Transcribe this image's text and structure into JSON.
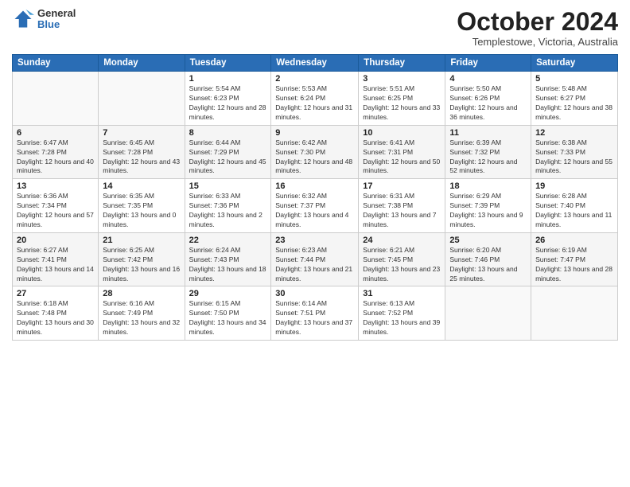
{
  "header": {
    "logo_general": "General",
    "logo_blue": "Blue",
    "month_title": "October 2024",
    "location": "Templestowe, Victoria, Australia"
  },
  "days_of_week": [
    "Sunday",
    "Monday",
    "Tuesday",
    "Wednesday",
    "Thursday",
    "Friday",
    "Saturday"
  ],
  "weeks": [
    [
      {
        "day": "",
        "info": ""
      },
      {
        "day": "",
        "info": ""
      },
      {
        "day": "1",
        "info": "Sunrise: 5:54 AM\nSunset: 6:23 PM\nDaylight: 12 hours and 28 minutes."
      },
      {
        "day": "2",
        "info": "Sunrise: 5:53 AM\nSunset: 6:24 PM\nDaylight: 12 hours and 31 minutes."
      },
      {
        "day": "3",
        "info": "Sunrise: 5:51 AM\nSunset: 6:25 PM\nDaylight: 12 hours and 33 minutes."
      },
      {
        "day": "4",
        "info": "Sunrise: 5:50 AM\nSunset: 6:26 PM\nDaylight: 12 hours and 36 minutes."
      },
      {
        "day": "5",
        "info": "Sunrise: 5:48 AM\nSunset: 6:27 PM\nDaylight: 12 hours and 38 minutes."
      }
    ],
    [
      {
        "day": "6",
        "info": "Sunrise: 6:47 AM\nSunset: 7:28 PM\nDaylight: 12 hours and 40 minutes."
      },
      {
        "day": "7",
        "info": "Sunrise: 6:45 AM\nSunset: 7:28 PM\nDaylight: 12 hours and 43 minutes."
      },
      {
        "day": "8",
        "info": "Sunrise: 6:44 AM\nSunset: 7:29 PM\nDaylight: 12 hours and 45 minutes."
      },
      {
        "day": "9",
        "info": "Sunrise: 6:42 AM\nSunset: 7:30 PM\nDaylight: 12 hours and 48 minutes."
      },
      {
        "day": "10",
        "info": "Sunrise: 6:41 AM\nSunset: 7:31 PM\nDaylight: 12 hours and 50 minutes."
      },
      {
        "day": "11",
        "info": "Sunrise: 6:39 AM\nSunset: 7:32 PM\nDaylight: 12 hours and 52 minutes."
      },
      {
        "day": "12",
        "info": "Sunrise: 6:38 AM\nSunset: 7:33 PM\nDaylight: 12 hours and 55 minutes."
      }
    ],
    [
      {
        "day": "13",
        "info": "Sunrise: 6:36 AM\nSunset: 7:34 PM\nDaylight: 12 hours and 57 minutes."
      },
      {
        "day": "14",
        "info": "Sunrise: 6:35 AM\nSunset: 7:35 PM\nDaylight: 13 hours and 0 minutes."
      },
      {
        "day": "15",
        "info": "Sunrise: 6:33 AM\nSunset: 7:36 PM\nDaylight: 13 hours and 2 minutes."
      },
      {
        "day": "16",
        "info": "Sunrise: 6:32 AM\nSunset: 7:37 PM\nDaylight: 13 hours and 4 minutes."
      },
      {
        "day": "17",
        "info": "Sunrise: 6:31 AM\nSunset: 7:38 PM\nDaylight: 13 hours and 7 minutes."
      },
      {
        "day": "18",
        "info": "Sunrise: 6:29 AM\nSunset: 7:39 PM\nDaylight: 13 hours and 9 minutes."
      },
      {
        "day": "19",
        "info": "Sunrise: 6:28 AM\nSunset: 7:40 PM\nDaylight: 13 hours and 11 minutes."
      }
    ],
    [
      {
        "day": "20",
        "info": "Sunrise: 6:27 AM\nSunset: 7:41 PM\nDaylight: 13 hours and 14 minutes."
      },
      {
        "day": "21",
        "info": "Sunrise: 6:25 AM\nSunset: 7:42 PM\nDaylight: 13 hours and 16 minutes."
      },
      {
        "day": "22",
        "info": "Sunrise: 6:24 AM\nSunset: 7:43 PM\nDaylight: 13 hours and 18 minutes."
      },
      {
        "day": "23",
        "info": "Sunrise: 6:23 AM\nSunset: 7:44 PM\nDaylight: 13 hours and 21 minutes."
      },
      {
        "day": "24",
        "info": "Sunrise: 6:21 AM\nSunset: 7:45 PM\nDaylight: 13 hours and 23 minutes."
      },
      {
        "day": "25",
        "info": "Sunrise: 6:20 AM\nSunset: 7:46 PM\nDaylight: 13 hours and 25 minutes."
      },
      {
        "day": "26",
        "info": "Sunrise: 6:19 AM\nSunset: 7:47 PM\nDaylight: 13 hours and 28 minutes."
      }
    ],
    [
      {
        "day": "27",
        "info": "Sunrise: 6:18 AM\nSunset: 7:48 PM\nDaylight: 13 hours and 30 minutes."
      },
      {
        "day": "28",
        "info": "Sunrise: 6:16 AM\nSunset: 7:49 PM\nDaylight: 13 hours and 32 minutes."
      },
      {
        "day": "29",
        "info": "Sunrise: 6:15 AM\nSunset: 7:50 PM\nDaylight: 13 hours and 34 minutes."
      },
      {
        "day": "30",
        "info": "Sunrise: 6:14 AM\nSunset: 7:51 PM\nDaylight: 13 hours and 37 minutes."
      },
      {
        "day": "31",
        "info": "Sunrise: 6:13 AM\nSunset: 7:52 PM\nDaylight: 13 hours and 39 minutes."
      },
      {
        "day": "",
        "info": ""
      },
      {
        "day": "",
        "info": ""
      }
    ]
  ]
}
